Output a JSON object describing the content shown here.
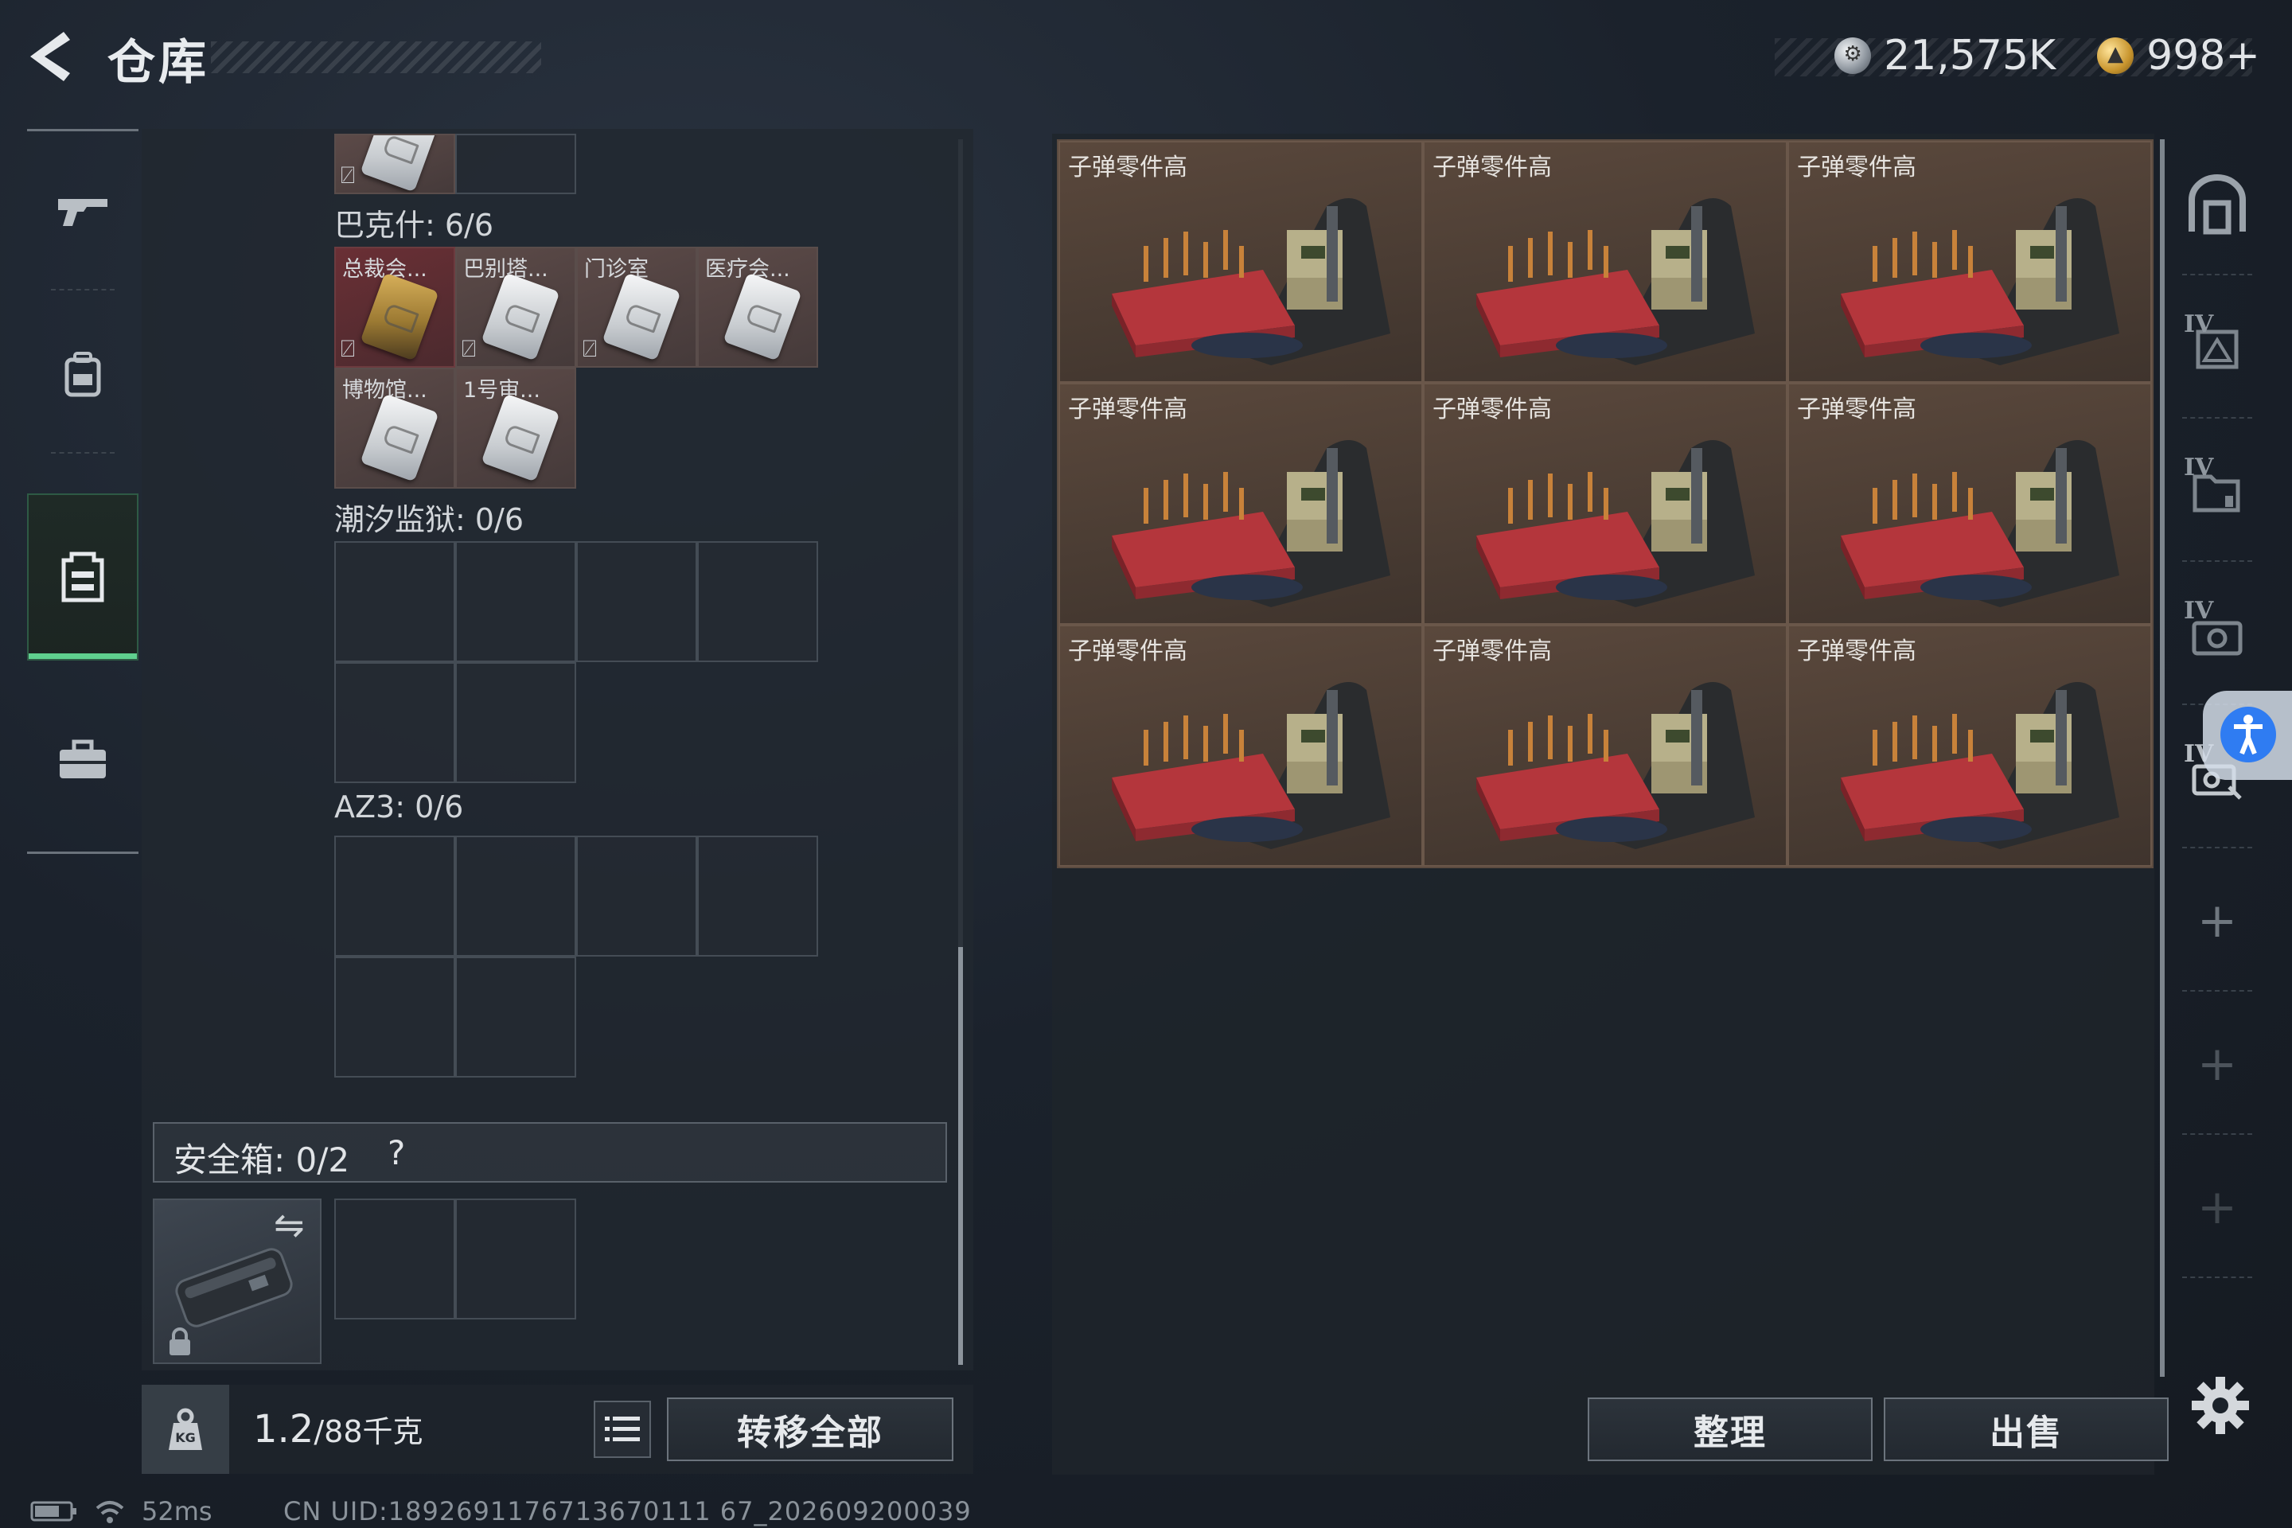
{
  "header": {
    "title": "仓库"
  },
  "currency": {
    "silver": "21,575K",
    "gold": "998+"
  },
  "left_nav": [
    "gun-icon",
    "backpack-icon",
    "vest-icon",
    "briefcase-icon"
  ],
  "backpack": {
    "top_cells": {
      "partial_item": "key-card"
    },
    "sections": [
      {
        "title": "巴克什: 6/6",
        "items": [
          {
            "label": "总裁会...",
            "color": "red",
            "card": "gold",
            "unbound": true
          },
          {
            "label": "巴别塔...",
            "color": "brown",
            "card": "silver",
            "unbound": true
          },
          {
            "label": "门诊室",
            "color": "brown",
            "card": "silver",
            "unbound": true
          },
          {
            "label": "医疗会...",
            "color": "brown",
            "card": "silver",
            "unbound": false
          },
          {
            "label": "博物馆...",
            "color": "brown",
            "card": "silver",
            "unbound": false
          },
          {
            "label": "1号审...",
            "color": "brown",
            "card": "silver",
            "unbound": false
          }
        ]
      },
      {
        "title": "潮汐监狱: 0/6"
      },
      {
        "title": "AZ3: 0/6"
      }
    ],
    "safe_box": {
      "label": "安全箱: 0/2",
      "help": "?"
    },
    "weight": {
      "current": "1.2",
      "max": "/88千克"
    },
    "transfer_all": "转移全部"
  },
  "stash": {
    "item_label": "子弹零件高",
    "items": [
      "子弹零件高",
      "子弹零件高",
      "子弹零件高",
      "子弹零件高",
      "子弹零件高",
      "子弹零件高",
      "子弹零件高",
      "子弹零件高",
      "子弹零件高"
    ]
  },
  "right_nav": {
    "tabs": [
      "stash-home-icon",
      "IV",
      "IV",
      "IV",
      "IV"
    ],
    "add_slots": 3
  },
  "buttons": {
    "sort": "整理",
    "sell": "出售"
  },
  "status": {
    "ping": "52ms",
    "uid": "CN UID:1892691176713670111 67_202609200039"
  }
}
